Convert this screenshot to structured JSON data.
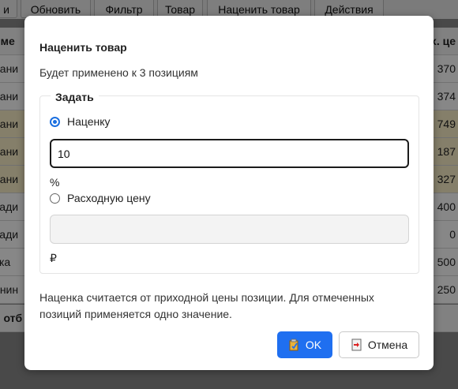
{
  "toolbar": {
    "buttons": [
      "и",
      "Обновить",
      "Фильтр",
      "Товар",
      "Наценить товар",
      "Действия"
    ]
  },
  "table": {
    "header": {
      "left": "име",
      "right": "х. це"
    },
    "rows": [
      {
        "left": "рани",
        "right": "370",
        "highlight": false
      },
      {
        "left": "рани",
        "right": "374",
        "highlight": false
      },
      {
        "left": "рани",
        "right": "749",
        "highlight": true
      },
      {
        "left": "рани",
        "right": "187",
        "highlight": true
      },
      {
        "left": "рани",
        "right": "327",
        "highlight": true
      },
      {
        "left": "вади",
        "right": "400",
        "highlight": false
      },
      {
        "left": "вади",
        "right": "0",
        "highlight": false
      },
      {
        "left": "ука",
        "right": "500",
        "highlight": false
      },
      {
        "left": "инин",
        "right": "250",
        "highlight": false
      }
    ],
    "footer": {
      "left": "о отб",
      "right": ""
    }
  },
  "dialog": {
    "title": "Наценить товар",
    "subtitle": "Будет применено к 3 позициям",
    "group_legend": "Задать",
    "markup_option": {
      "label": "Наценку",
      "checked": true,
      "value": "10",
      "unit": "%"
    },
    "cost_option": {
      "label": "Расходную цену",
      "checked": false,
      "value": "",
      "unit": "₽"
    },
    "note": "Наценка считается от приходной цены позиции. Для отмеченных позиций применяется одно значение.",
    "ok_label": "OK",
    "cancel_label": "Отмена"
  },
  "colors": {
    "accent": "#1f6ff0",
    "highlight_row": "#fbf0c9"
  },
  "icons": {
    "ok": "checklist-icon",
    "cancel": "exit-door-icon"
  }
}
